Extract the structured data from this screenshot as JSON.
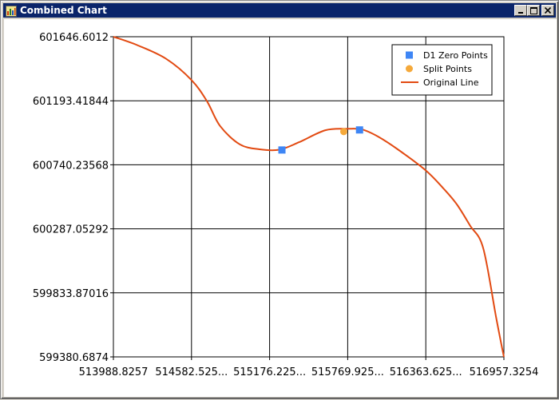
{
  "window": {
    "title": "Combined Chart",
    "icon": "app-window-icon",
    "controls": [
      "minimize-icon",
      "maximize-icon",
      "close-icon"
    ]
  },
  "colors": {
    "titlebar": "#0a246a",
    "line": "#e24a12",
    "d1_points": "#3e86f5",
    "split_points": "#f5a93a",
    "grid": "#000000"
  },
  "chart_data": {
    "type": "line",
    "title": "",
    "xlabel": "",
    "ylabel": "",
    "xlim": [
      513988.8257,
      516957.3254
    ],
    "ylim": [
      599380.6874,
      601646.6012
    ],
    "x_tick_labels": [
      "513988.8257",
      "514582.525...",
      "515176.225...",
      "515769.925...",
      "516363.625...",
      "516957.3254"
    ],
    "y_tick_labels": [
      "601646.6012",
      "601193.41844",
      "600740.23568",
      "600287.05292",
      "599833.87016",
      "599380.6874"
    ],
    "grid": true,
    "legend": {
      "placement": "top-right",
      "entries": [
        "D1 Zero Points",
        "Split Points",
        "Original Line"
      ]
    },
    "series": [
      {
        "name": "Original Line",
        "marker": "line",
        "x": [
          513988.8257,
          514170,
          514390,
          514582.5,
          514700,
          514800,
          514950,
          515100,
          515250,
          515400,
          515600,
          515769.9,
          515880,
          516000,
          516150,
          516363.6,
          516500,
          516600,
          516700,
          516800,
          516900,
          516957.3254
        ],
        "y": [
          601646.6012,
          601587,
          601490,
          601340,
          601190,
          601015,
          600885,
          600850,
          600847,
          600900,
          600985,
          600995,
          600990,
          600940,
          600850,
          600700,
          600570,
          600460,
          600310,
          600150,
          599650,
          599380.6874
        ]
      },
      {
        "name": "D1 Zero Points",
        "marker": "square",
        "x": [
          515270,
          515860
        ],
        "y": [
          600845,
          600987
        ]
      },
      {
        "name": "Split Points",
        "marker": "circle",
        "x": [
          515740
        ],
        "y": [
          600975
        ]
      }
    ]
  }
}
